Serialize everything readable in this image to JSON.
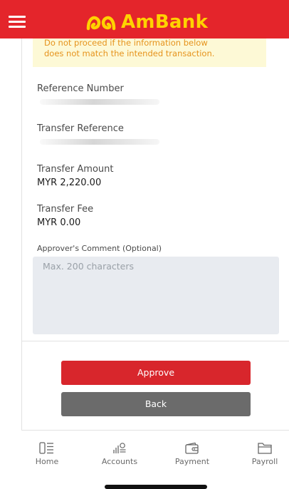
{
  "header": {
    "brand_name": "AmBank",
    "menu_icon": "hamburger-menu-icon",
    "logo_icon": "ambank-logo-icon",
    "background_color": "#e4252b",
    "brand_color": "#ffd200"
  },
  "warning": {
    "line1": "Do not proceed if the information below",
    "line2": "does not match the intended transaction.",
    "text_color": "#e6931c",
    "background_color": "#fdf9d6"
  },
  "fields": {
    "reference_number": {
      "label": "Reference Number"
    },
    "transfer_reference": {
      "label": "Transfer Reference"
    },
    "transfer_amount": {
      "label": "Transfer Amount",
      "value": "MYR 2,220.00"
    },
    "transfer_fee": {
      "label": "Transfer Fee",
      "value": "MYR 0.00"
    }
  },
  "comment": {
    "label": "Approver's Comment (Optional)",
    "placeholder": "Max. 200 characters",
    "value": ""
  },
  "actions": {
    "approve_label": "Approve",
    "back_label": "Back",
    "approve_color": "#d8262c",
    "back_color": "#6b6b6b"
  },
  "tabbar": {
    "items": [
      {
        "label": "Home",
        "icon": "home-icon"
      },
      {
        "label": "Accounts",
        "icon": "accounts-icon"
      },
      {
        "label": "Payment",
        "icon": "wallet-icon"
      },
      {
        "label": "Payroll",
        "icon": "folder-icon"
      }
    ]
  }
}
